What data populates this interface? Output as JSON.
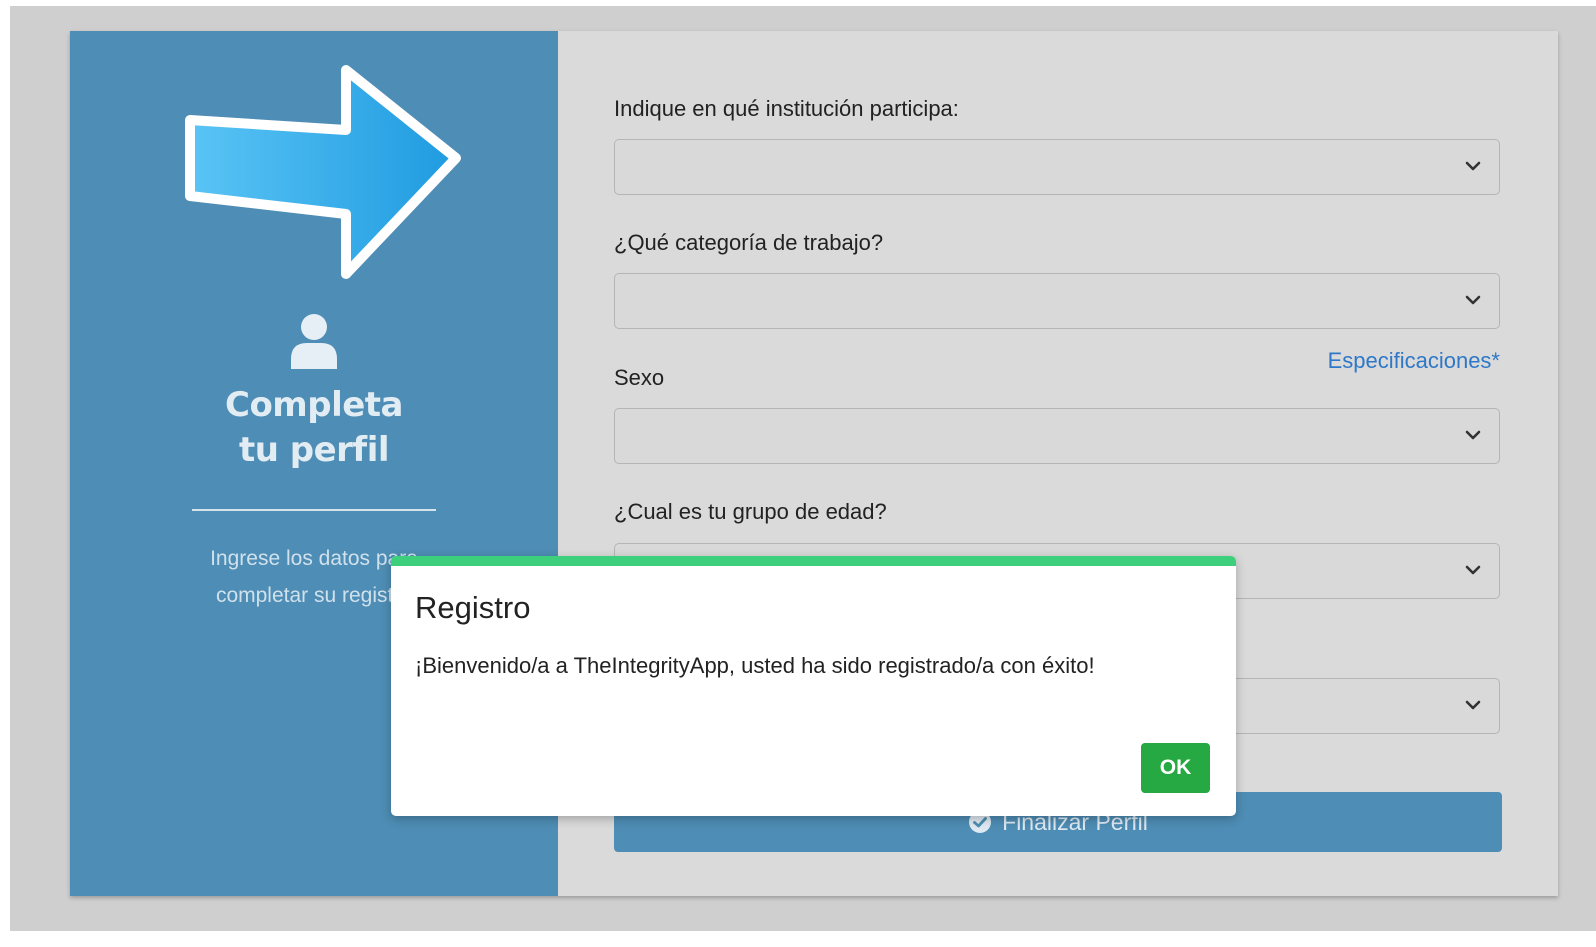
{
  "sidebar": {
    "title_line1": "Completa",
    "title_line2": "tu perfil",
    "subtitle_line1": "Ingrese los datos para",
    "subtitle_line2": "completar su registro"
  },
  "form": {
    "institution_label": "Indique en qué institución participa:",
    "institution_value": "",
    "category_label": "¿Qué categoría de trabajo?",
    "category_value": "",
    "specifications_link": "Especificaciones*",
    "sex_label": "Sexo",
    "sex_value": "",
    "age_group_label": "¿Cual es tu grupo de edad?",
    "age_group_value": "",
    "fifth_field_value": "",
    "finalize_button": "Finalizar Perfil"
  },
  "modal": {
    "title": "Registro",
    "message": "¡Bienvenido/a a TheIntegrityApp, usted ha sido registrado/a con éxito!",
    "ok_button": "OK"
  },
  "colors": {
    "sidebar_bg": "#4e8db5",
    "card_bg": "#dadada",
    "modal_accent": "#3ecf7d",
    "ok_button": "#26a842",
    "link": "#2e78c7"
  },
  "icons": [
    "arrow-right-icon",
    "user-icon",
    "chevron-down-icon",
    "check-circle-icon"
  ]
}
